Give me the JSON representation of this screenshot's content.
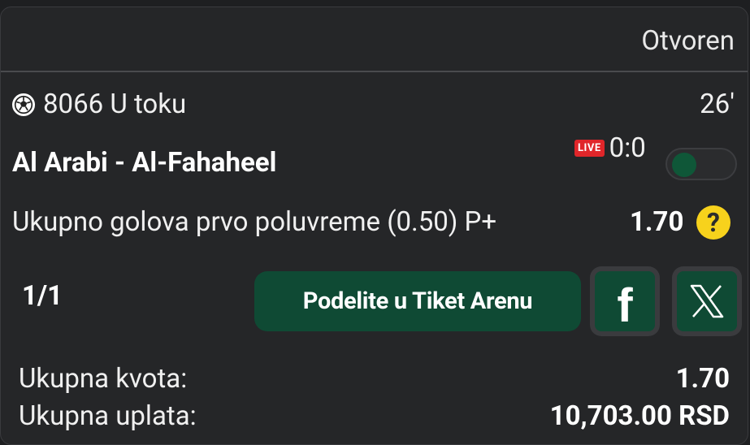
{
  "ticket": {
    "status": "Otvoren"
  },
  "match": {
    "sport_icon": "soccer-ball-icon",
    "code_status": "8066 U toku",
    "minute": "26'",
    "teams": "Al Arabi - Al-Fahaheel",
    "live_label": "LIVE",
    "score": "0:0",
    "toggle_on": true
  },
  "bet": {
    "market": "Ukupno golova prvo poluvreme (0.50) P+",
    "odd": "1.70",
    "help_symbol": "?"
  },
  "share": {
    "count": "1/1",
    "button_label": "Podelite u Tiket Arenu",
    "facebook_label": "f",
    "x_icon": "x-logo-icon"
  },
  "summary": {
    "total_odds_label": "Ukupna kvota:",
    "total_odds_value": "1.70",
    "total_stake_label": "Ukupna uplata:",
    "total_stake_value": "10,703.00 RSD"
  },
  "colors": {
    "accent_green": "#0f4a34",
    "live_red": "#e0262a",
    "help_yellow": "#f7d21c",
    "background": "#252628"
  }
}
